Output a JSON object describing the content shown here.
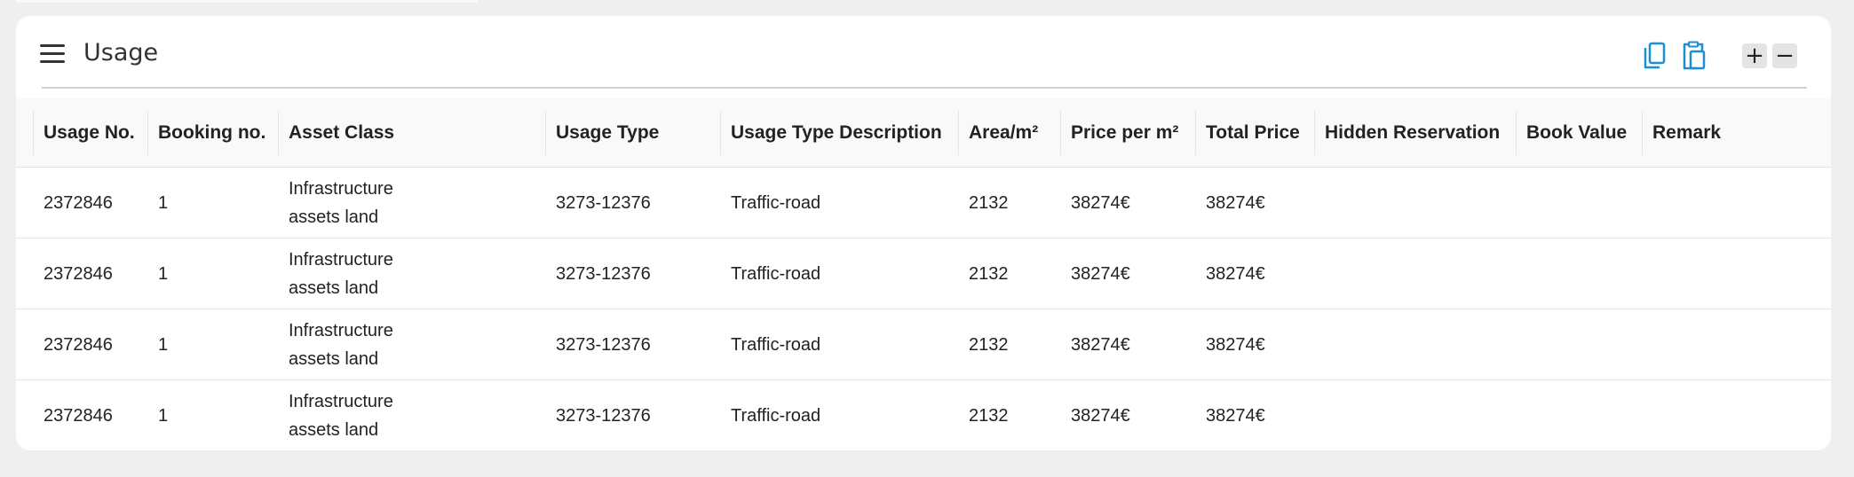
{
  "panel": {
    "title": "Usage",
    "icons": {
      "menu": "hamburger-menu-icon",
      "copy": "copy-icon",
      "paste": "clipboard-icon",
      "zoom_in": "plus-icon",
      "zoom_out": "minus-icon"
    },
    "zoom_in_label": "+",
    "zoom_out_label": "−",
    "accent_color": "#1a8fd6"
  },
  "table": {
    "columns": [
      "Usage No.",
      "Booking no.",
      "Asset Class",
      "Usage Type",
      "Usage Type Description",
      "Area/m²",
      "Price per m²",
      "Total Price",
      "Hidden Reservation",
      "Book Value",
      "Remark"
    ],
    "rows": [
      [
        "2372846",
        "1",
        "Infrastructure assets land",
        "3273-12376",
        "Traffic-road",
        "2132",
        "38274€",
        "38274€",
        "",
        "",
        ""
      ],
      [
        "2372846",
        "1",
        "Infrastructure assets land",
        "3273-12376",
        "Traffic-road",
        "2132",
        "38274€",
        "38274€",
        "",
        "",
        ""
      ],
      [
        "2372846",
        "1",
        "Infrastructure assets land",
        "3273-12376",
        "Traffic-road",
        "2132",
        "38274€",
        "38274€",
        "",
        "",
        ""
      ],
      [
        "2372846",
        "1",
        "Infrastructure assets land",
        "3273-12376",
        "Traffic-road",
        "2132",
        "38274€",
        "38274€",
        "",
        "",
        ""
      ]
    ]
  }
}
